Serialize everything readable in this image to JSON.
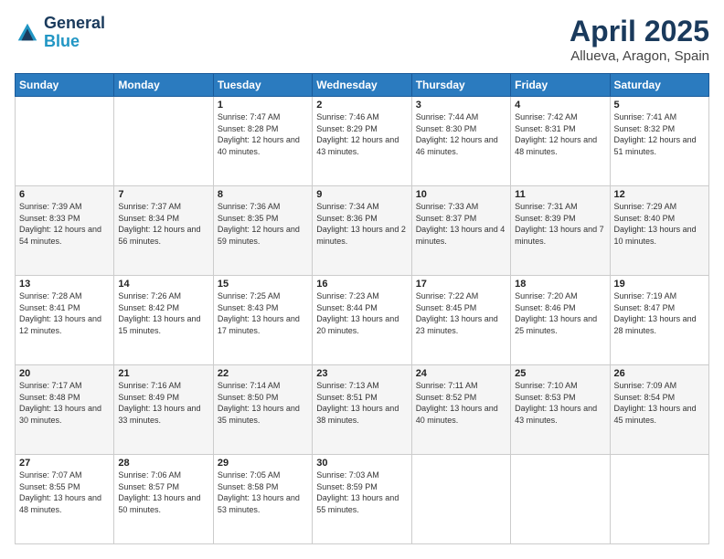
{
  "header": {
    "logo_line1": "General",
    "logo_line2": "Blue",
    "title": "April 2025",
    "subtitle": "Allueva, Aragon, Spain"
  },
  "weekdays": [
    "Sunday",
    "Monday",
    "Tuesday",
    "Wednesday",
    "Thursday",
    "Friday",
    "Saturday"
  ],
  "weeks": [
    [
      {
        "day": "",
        "sunrise": "",
        "sunset": "",
        "daylight": ""
      },
      {
        "day": "",
        "sunrise": "",
        "sunset": "",
        "daylight": ""
      },
      {
        "day": "1",
        "sunrise": "Sunrise: 7:47 AM",
        "sunset": "Sunset: 8:28 PM",
        "daylight": "Daylight: 12 hours and 40 minutes."
      },
      {
        "day": "2",
        "sunrise": "Sunrise: 7:46 AM",
        "sunset": "Sunset: 8:29 PM",
        "daylight": "Daylight: 12 hours and 43 minutes."
      },
      {
        "day": "3",
        "sunrise": "Sunrise: 7:44 AM",
        "sunset": "Sunset: 8:30 PM",
        "daylight": "Daylight: 12 hours and 46 minutes."
      },
      {
        "day": "4",
        "sunrise": "Sunrise: 7:42 AM",
        "sunset": "Sunset: 8:31 PM",
        "daylight": "Daylight: 12 hours and 48 minutes."
      },
      {
        "day": "5",
        "sunrise": "Sunrise: 7:41 AM",
        "sunset": "Sunset: 8:32 PM",
        "daylight": "Daylight: 12 hours and 51 minutes."
      }
    ],
    [
      {
        "day": "6",
        "sunrise": "Sunrise: 7:39 AM",
        "sunset": "Sunset: 8:33 PM",
        "daylight": "Daylight: 12 hours and 54 minutes."
      },
      {
        "day": "7",
        "sunrise": "Sunrise: 7:37 AM",
        "sunset": "Sunset: 8:34 PM",
        "daylight": "Daylight: 12 hours and 56 minutes."
      },
      {
        "day": "8",
        "sunrise": "Sunrise: 7:36 AM",
        "sunset": "Sunset: 8:35 PM",
        "daylight": "Daylight: 12 hours and 59 minutes."
      },
      {
        "day": "9",
        "sunrise": "Sunrise: 7:34 AM",
        "sunset": "Sunset: 8:36 PM",
        "daylight": "Daylight: 13 hours and 2 minutes."
      },
      {
        "day": "10",
        "sunrise": "Sunrise: 7:33 AM",
        "sunset": "Sunset: 8:37 PM",
        "daylight": "Daylight: 13 hours and 4 minutes."
      },
      {
        "day": "11",
        "sunrise": "Sunrise: 7:31 AM",
        "sunset": "Sunset: 8:39 PM",
        "daylight": "Daylight: 13 hours and 7 minutes."
      },
      {
        "day": "12",
        "sunrise": "Sunrise: 7:29 AM",
        "sunset": "Sunset: 8:40 PM",
        "daylight": "Daylight: 13 hours and 10 minutes."
      }
    ],
    [
      {
        "day": "13",
        "sunrise": "Sunrise: 7:28 AM",
        "sunset": "Sunset: 8:41 PM",
        "daylight": "Daylight: 13 hours and 12 minutes."
      },
      {
        "day": "14",
        "sunrise": "Sunrise: 7:26 AM",
        "sunset": "Sunset: 8:42 PM",
        "daylight": "Daylight: 13 hours and 15 minutes."
      },
      {
        "day": "15",
        "sunrise": "Sunrise: 7:25 AM",
        "sunset": "Sunset: 8:43 PM",
        "daylight": "Daylight: 13 hours and 17 minutes."
      },
      {
        "day": "16",
        "sunrise": "Sunrise: 7:23 AM",
        "sunset": "Sunset: 8:44 PM",
        "daylight": "Daylight: 13 hours and 20 minutes."
      },
      {
        "day": "17",
        "sunrise": "Sunrise: 7:22 AM",
        "sunset": "Sunset: 8:45 PM",
        "daylight": "Daylight: 13 hours and 23 minutes."
      },
      {
        "day": "18",
        "sunrise": "Sunrise: 7:20 AM",
        "sunset": "Sunset: 8:46 PM",
        "daylight": "Daylight: 13 hours and 25 minutes."
      },
      {
        "day": "19",
        "sunrise": "Sunrise: 7:19 AM",
        "sunset": "Sunset: 8:47 PM",
        "daylight": "Daylight: 13 hours and 28 minutes."
      }
    ],
    [
      {
        "day": "20",
        "sunrise": "Sunrise: 7:17 AM",
        "sunset": "Sunset: 8:48 PM",
        "daylight": "Daylight: 13 hours and 30 minutes."
      },
      {
        "day": "21",
        "sunrise": "Sunrise: 7:16 AM",
        "sunset": "Sunset: 8:49 PM",
        "daylight": "Daylight: 13 hours and 33 minutes."
      },
      {
        "day": "22",
        "sunrise": "Sunrise: 7:14 AM",
        "sunset": "Sunset: 8:50 PM",
        "daylight": "Daylight: 13 hours and 35 minutes."
      },
      {
        "day": "23",
        "sunrise": "Sunrise: 7:13 AM",
        "sunset": "Sunset: 8:51 PM",
        "daylight": "Daylight: 13 hours and 38 minutes."
      },
      {
        "day": "24",
        "sunrise": "Sunrise: 7:11 AM",
        "sunset": "Sunset: 8:52 PM",
        "daylight": "Daylight: 13 hours and 40 minutes."
      },
      {
        "day": "25",
        "sunrise": "Sunrise: 7:10 AM",
        "sunset": "Sunset: 8:53 PM",
        "daylight": "Daylight: 13 hours and 43 minutes."
      },
      {
        "day": "26",
        "sunrise": "Sunrise: 7:09 AM",
        "sunset": "Sunset: 8:54 PM",
        "daylight": "Daylight: 13 hours and 45 minutes."
      }
    ],
    [
      {
        "day": "27",
        "sunrise": "Sunrise: 7:07 AM",
        "sunset": "Sunset: 8:55 PM",
        "daylight": "Daylight: 13 hours and 48 minutes."
      },
      {
        "day": "28",
        "sunrise": "Sunrise: 7:06 AM",
        "sunset": "Sunset: 8:57 PM",
        "daylight": "Daylight: 13 hours and 50 minutes."
      },
      {
        "day": "29",
        "sunrise": "Sunrise: 7:05 AM",
        "sunset": "Sunset: 8:58 PM",
        "daylight": "Daylight: 13 hours and 53 minutes."
      },
      {
        "day": "30",
        "sunrise": "Sunrise: 7:03 AM",
        "sunset": "Sunset: 8:59 PM",
        "daylight": "Daylight: 13 hours and 55 minutes."
      },
      {
        "day": "",
        "sunrise": "",
        "sunset": "",
        "daylight": ""
      },
      {
        "day": "",
        "sunrise": "",
        "sunset": "",
        "daylight": ""
      },
      {
        "day": "",
        "sunrise": "",
        "sunset": "",
        "daylight": ""
      }
    ]
  ]
}
